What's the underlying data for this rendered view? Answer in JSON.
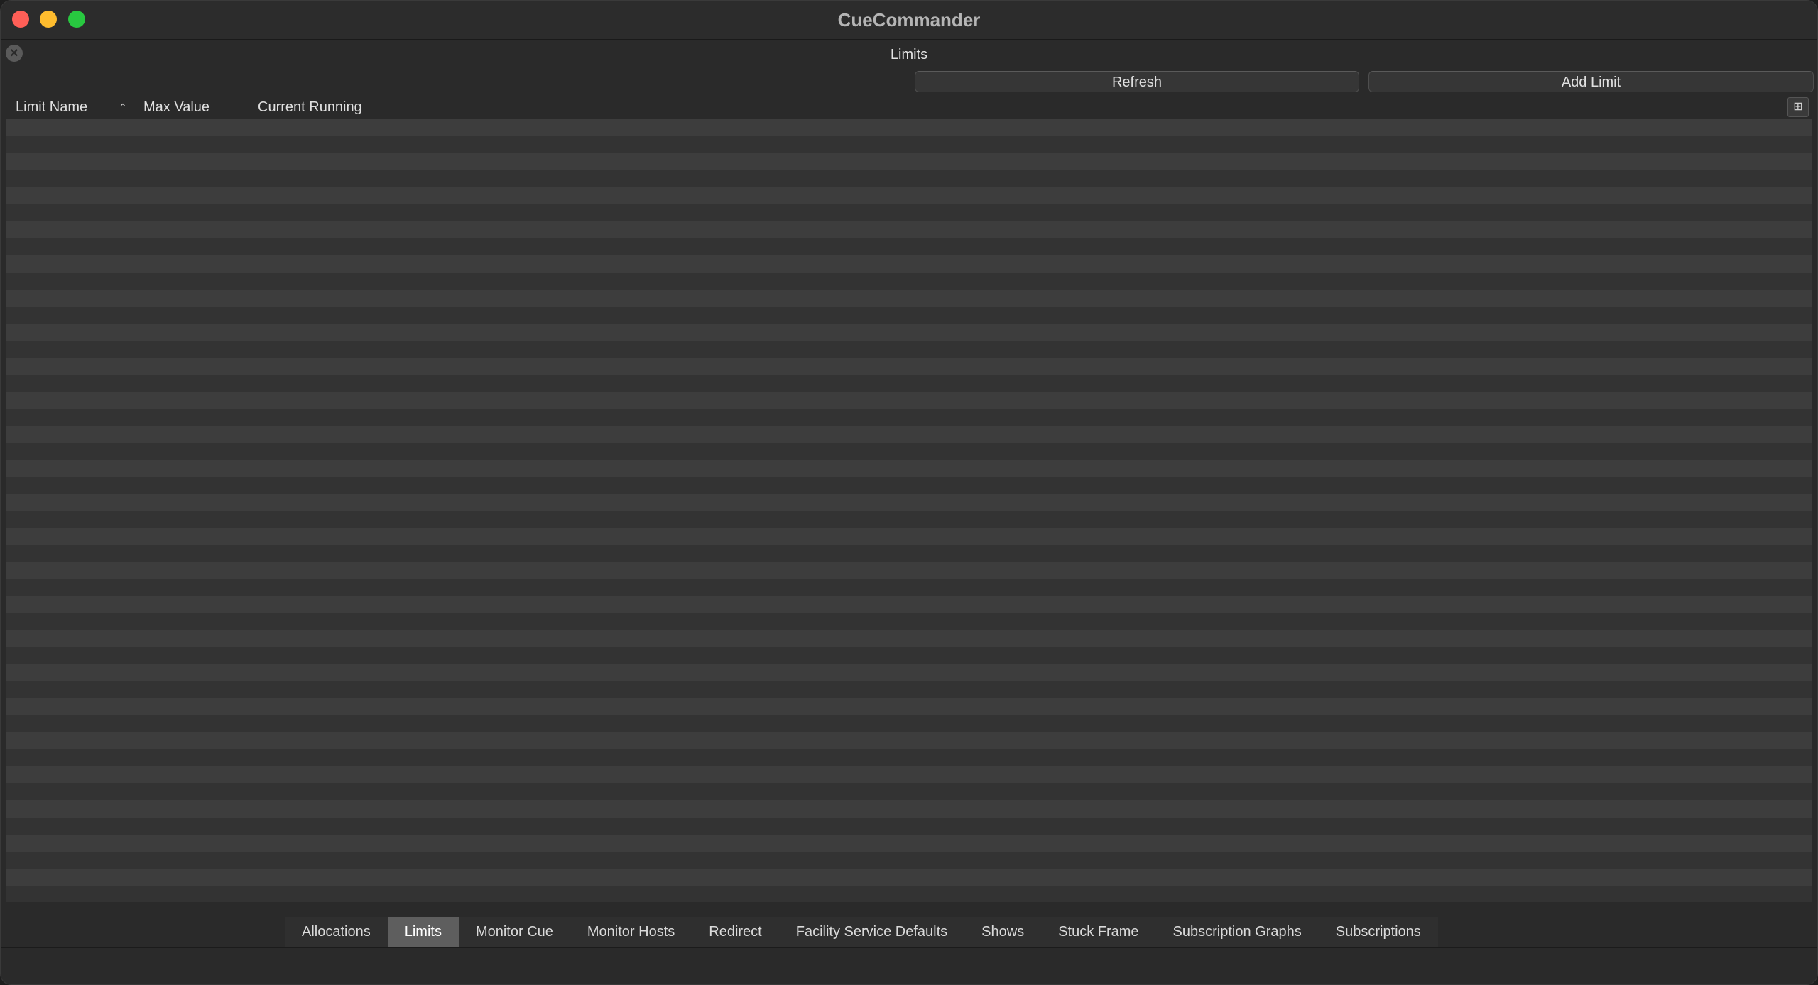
{
  "window": {
    "title": "CueCommander"
  },
  "dock": {
    "title": "Limits",
    "close_icon": "close-circle-icon"
  },
  "toolbar": {
    "refresh_label": "Refresh",
    "add_limit_label": "Add Limit"
  },
  "table": {
    "columns": [
      "Limit Name",
      "Max Value",
      "Current Running"
    ],
    "sort_indicator": "⌃",
    "sorted_column": "Limit Name",
    "rows": []
  },
  "tabs": [
    {
      "label": "Allocations",
      "active": false
    },
    {
      "label": "Limits",
      "active": true
    },
    {
      "label": "Monitor Cue",
      "active": false
    },
    {
      "label": "Monitor Hosts",
      "active": false
    },
    {
      "label": "Redirect",
      "active": false
    },
    {
      "label": "Facility Service Defaults",
      "active": false
    },
    {
      "label": "Shows",
      "active": false
    },
    {
      "label": "Stuck Frame",
      "active": false
    },
    {
      "label": "Subscription Graphs",
      "active": false
    },
    {
      "label": "Subscriptions",
      "active": false
    }
  ]
}
